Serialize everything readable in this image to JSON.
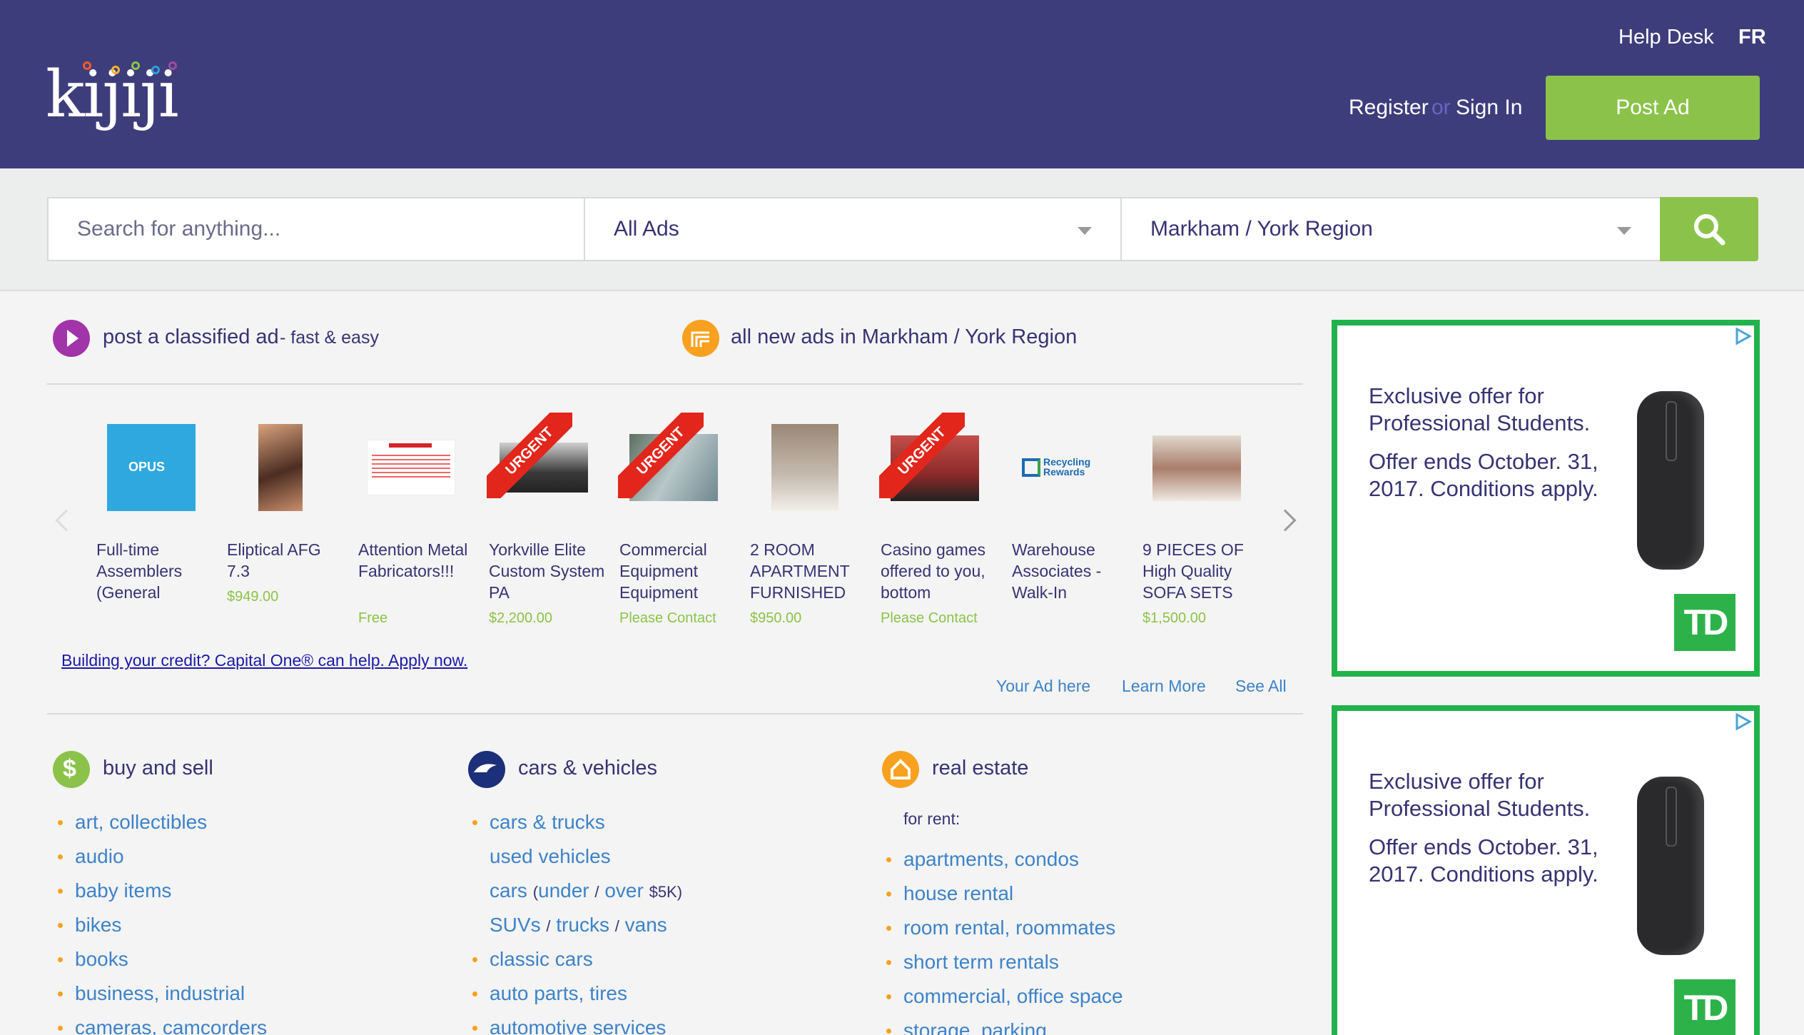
{
  "header": {
    "logo": "kijiji",
    "help_desk": "Help Desk",
    "lang": "FR",
    "register": "Register",
    "or": "or",
    "sign_in": "Sign In",
    "post_ad": "Post Ad"
  },
  "search": {
    "placeholder": "Search for anything...",
    "category": "All Ads",
    "location": "Markham / York Region"
  },
  "promo": {
    "post_classified": "post a classified ad",
    "post_classified_sub": "- fast & easy",
    "new_ads": "all new ads in Markham / York Region"
  },
  "carousel": {
    "items": [
      {
        "title": "Full-time Assemblers (General",
        "price": "",
        "urgent": false
      },
      {
        "title": "Eliptical AFG 7.3",
        "price": "$949.00",
        "urgent": false
      },
      {
        "title": "Attention Metal Fabricators!!!",
        "price": "Free",
        "urgent": false
      },
      {
        "title": "Yorkville Elite Custom System PA",
        "price": "$2,200.00",
        "urgent": true
      },
      {
        "title": "Commercial Equipment Equipment",
        "price": "Please Contact",
        "urgent": true
      },
      {
        "title": "2 ROOM APARTMENT FURNISHED",
        "price": "$950.00",
        "urgent": false
      },
      {
        "title": "Casino games offered to you, bottom",
        "price": "Please Contact",
        "urgent": true
      },
      {
        "title": "Warehouse Associates - Walk-In",
        "price": "",
        "urgent": false
      },
      {
        "title": "9 PIECES OF High Quality SOFA SETS",
        "price": "$1,500.00",
        "urgent": false
      }
    ],
    "urgent_label": "URGENT",
    "opus_label": "OPUS",
    "recycling_label": "Recycling Rewards",
    "capital_one": "Building your credit? Capital One® can help. Apply now.",
    "your_ad_here": "Your Ad here",
    "learn_more": "Learn More",
    "see_all": "See All"
  },
  "categories": {
    "buy_sell": {
      "title": "buy and sell",
      "items": [
        "art, collectibles",
        "audio",
        "baby items",
        "bikes",
        "books",
        "business, industrial",
        "cameras, camcorders"
      ]
    },
    "cars": {
      "title": "cars & vehicles",
      "cars_trucks": "cars & trucks",
      "used_vehicles": "used vehicles",
      "cars_word": "cars",
      "under": "under",
      "slash": "/",
      "over": "over",
      "five_k": "$5K)",
      "open_paren": "(",
      "suvs": "SUVs",
      "trucks": "trucks",
      "vans": "vans",
      "classic_cars": "classic cars",
      "auto_parts": "auto parts, tires",
      "automotive_services": "automotive services"
    },
    "real_estate": {
      "title": "real estate",
      "for_rent": "for rent:",
      "items": [
        "apartments, condos",
        "house rental",
        "room rental, roommates",
        "short term rentals",
        "commercial, office space",
        "storage, parking"
      ]
    }
  },
  "side_ads": [
    {
      "headline": "Exclusive offer for Professional Students.",
      "body": "Offer ends October. 31, 2017. Conditions apply.",
      "brand": "TD"
    },
    {
      "headline": "Exclusive offer for Professional Students.",
      "body": "Offer ends October. 31, 2017. Conditions apply.",
      "brand": "TD"
    }
  ],
  "colors": {
    "header_bg": "#3e3d7c",
    "accent_green": "#8bc34a",
    "link_blue": "#3e83c9",
    "td_green": "#22b24c"
  }
}
